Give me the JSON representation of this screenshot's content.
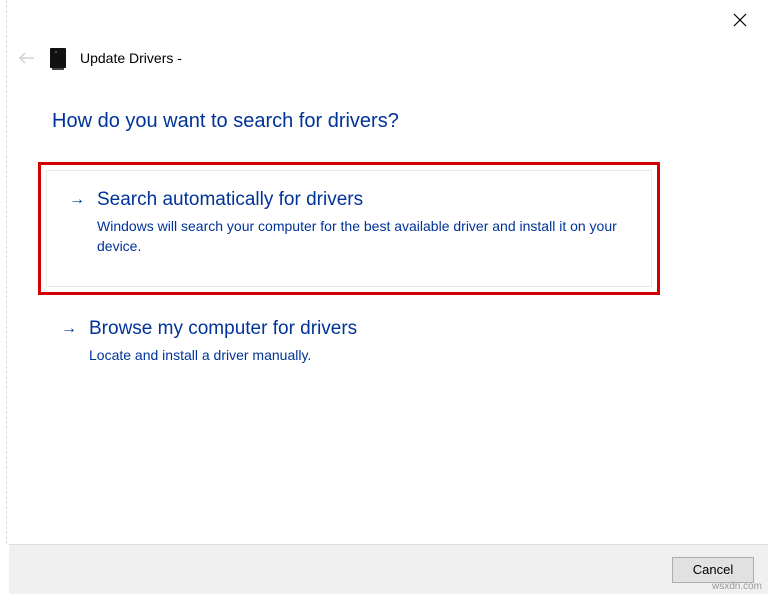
{
  "header": {
    "title": "Update Drivers -"
  },
  "question": "How do you want to search for drivers?",
  "options": {
    "auto": {
      "title": "Search automatically for drivers",
      "desc": "Windows will search your computer for the best available driver and install it on your device."
    },
    "browse": {
      "title": "Browse my computer for drivers",
      "desc": "Locate and install a driver manually."
    }
  },
  "footer": {
    "cancel": "Cancel"
  },
  "watermark": "wsxdn.com"
}
